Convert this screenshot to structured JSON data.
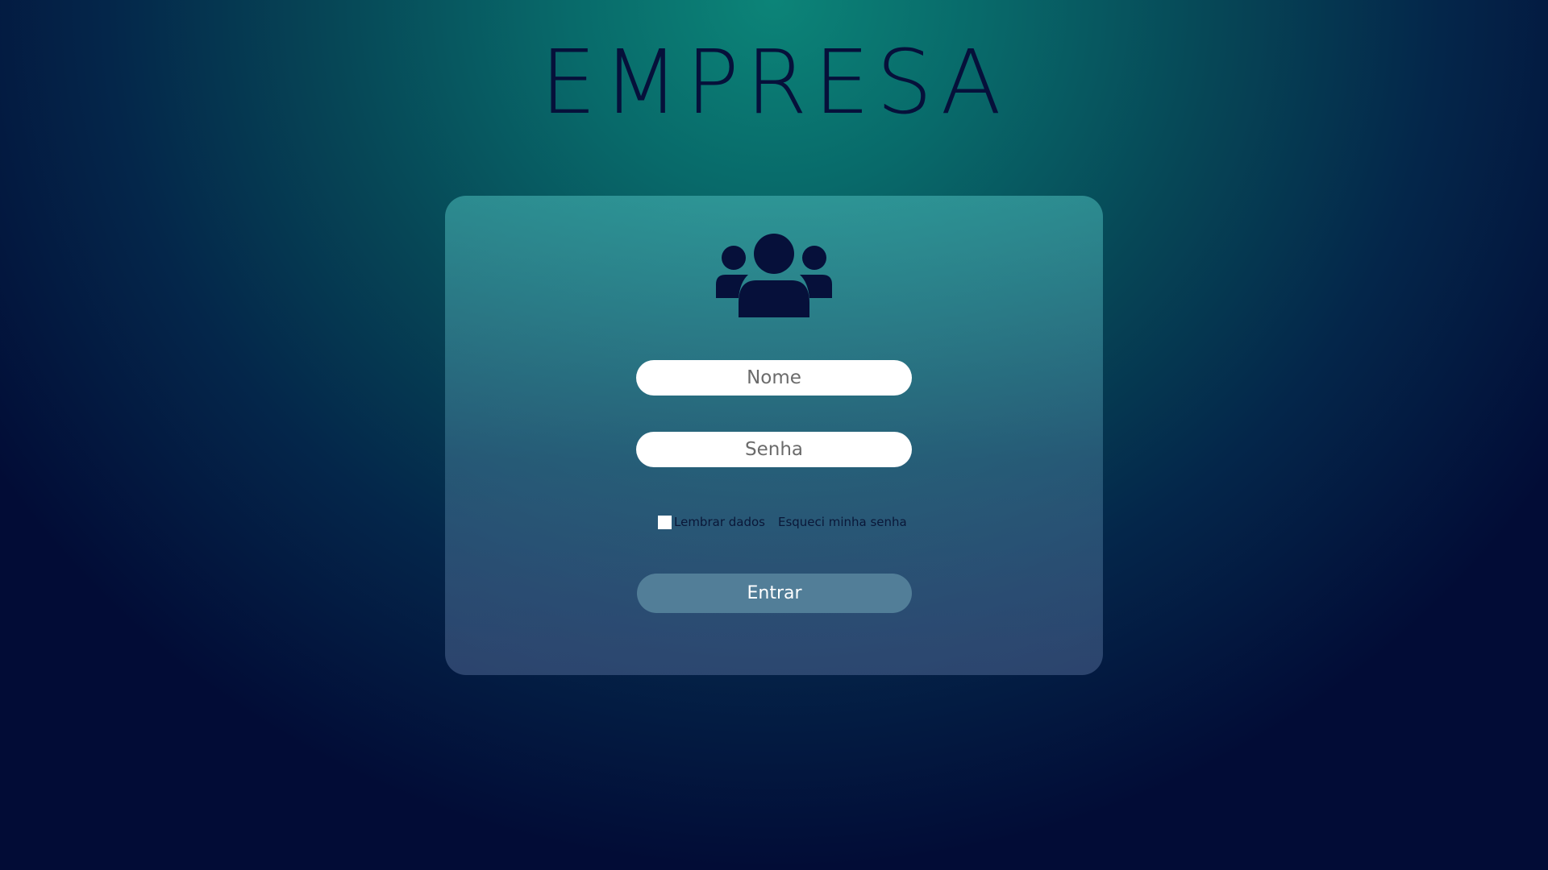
{
  "logo": {
    "text": "EMPRESA",
    "color": "#06103a"
  },
  "icon": {
    "name": "users-group-icon",
    "color": "#06103a"
  },
  "form": {
    "name_placeholder": "Nome",
    "name_value": "",
    "password_placeholder": "Senha",
    "password_value": "",
    "remember_label": "Lembrar dados",
    "remember_checked": false,
    "forgot_label": "Esqueci minha senha",
    "submit_label": "Entrar"
  },
  "colors": {
    "background_top": "#0c8478",
    "background_bottom": "#020c36",
    "button": "#527e98",
    "input": "#ffffff"
  }
}
